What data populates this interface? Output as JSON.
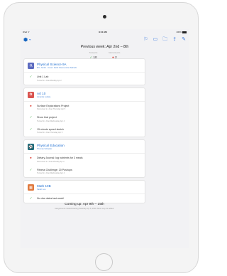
{
  "status_bar": {
    "left": "iPad ᯤ",
    "time": "9:41 AM",
    "battery": "100%"
  },
  "toolbar": {
    "icons": [
      "hexagon-logo-icon",
      "chevron-down-icon",
      "flag-icon",
      "calendar-icon",
      "folder-icon",
      "share-icon",
      "compose-icon"
    ]
  },
  "header": {
    "title": "Previous week: Apr 2nd – 8th",
    "turned_in_label": "Turned in",
    "not_turned_in_label": "Not turned in",
    "turned_in_count": "10",
    "not_turned_in_count": "2"
  },
  "classes": [
    {
      "name": "Physical Science 9A",
      "subtitle": "Mrs. Smith · Cover: Keith Owens-Jane Salcedo",
      "color": "#5c6bc0",
      "items": [
        {
          "status": "done",
          "title": "Unit 1 Lab",
          "sub": "Turned in • Due Monday Apr 2"
        }
      ]
    },
    {
      "name": "Art 10",
      "subtitle": "Amanda Ludwig",
      "color": "#d9534f",
      "items": [
        {
          "status": "missing",
          "title": "Surface Explorations Project",
          "sub": "Not turned in • Due Thursday Apr 5"
        },
        {
          "status": "done",
          "title": "Show that project",
          "sub": "Turned in • Due Wednesday Apr 4"
        },
        {
          "status": "done",
          "title": "15 minute speed sketch",
          "sub": "Turned in • Due Thursday Apr 5"
        }
      ]
    },
    {
      "name": "Physical Education",
      "subtitle": "Thomas Schaefer",
      "color": "#1e6b7a",
      "items": [
        {
          "status": "missing",
          "title": "Dietary Journal: log nutrients for 3 meals",
          "sub": "Not turned in • Due Monday Apr 2"
        },
        {
          "status": "done",
          "title": "Fitness Challenge: 20 Pushups",
          "sub": "Turned in • Due Wednesday Apr 4"
        }
      ]
    },
    {
      "name": "Math 10B",
      "subtitle": "Sarah Lee",
      "color": "#e07a3f",
      "items": [
        {
          "status": "done",
          "title": "No due dates last week!",
          "sub": ""
        }
      ]
    }
  ],
  "coming_up": {
    "title": "Coming up: Apr 9th – 15th",
    "note": "Assignments created starting Saturday Apr 8, 2018. More may be added."
  }
}
